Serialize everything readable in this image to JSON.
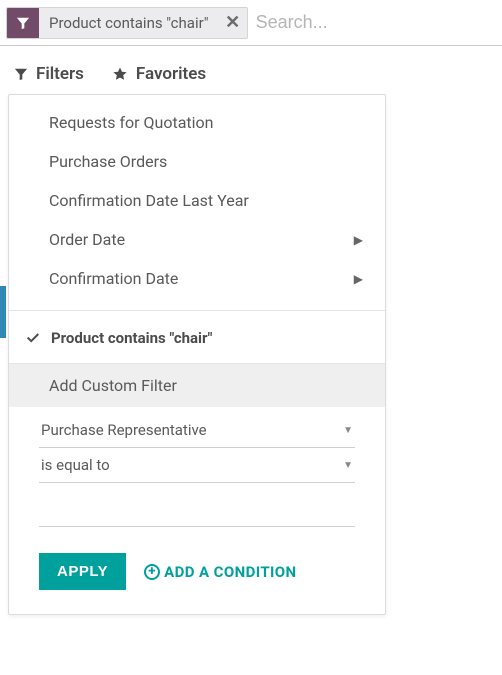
{
  "search": {
    "facet_label": "Product contains \"chair\"",
    "placeholder": "Search..."
  },
  "toolbar": {
    "filters_label": "Filters",
    "favorites_label": "Favorites"
  },
  "filters_menu": {
    "items": [
      {
        "label": "Requests for Quotation",
        "submenu": false
      },
      {
        "label": "Purchase Orders",
        "submenu": false
      },
      {
        "label": "Confirmation Date Last Year",
        "submenu": false
      },
      {
        "label": "Order Date",
        "submenu": true
      },
      {
        "label": "Confirmation Date",
        "submenu": true
      }
    ],
    "active_filter": "Product contains \"chair\"",
    "custom": {
      "header": "Add Custom Filter",
      "field": "Purchase Representative",
      "operator": "is equal to",
      "apply_label": "APPLY",
      "add_condition_label": "ADD A CONDITION"
    }
  }
}
